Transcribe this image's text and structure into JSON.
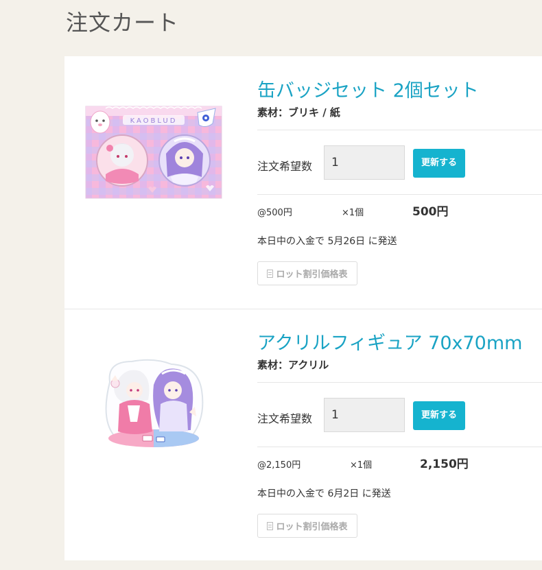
{
  "page": {
    "title": "注文カート"
  },
  "items": [
    {
      "title": "缶バッジセット 2個セット",
      "material": "素材：ブリキ / 紙",
      "qty_label": "注文希望数",
      "qty_value": "1",
      "update_label": "更新する",
      "unit_price": "@500円",
      "multiplier": "×1個",
      "subtotal": "500円",
      "shipping": "本日中の入金で 5月26日 に発送",
      "lot_table_label": "ロット割引価格表",
      "image_icon": "badge-set-image"
    },
    {
      "title": "アクリルフィギュア 70x70mm",
      "material": "素材：アクリル",
      "qty_label": "注文希望数",
      "qty_value": "1",
      "update_label": "更新する",
      "unit_price": "@2,150円",
      "multiplier": "×1個",
      "subtotal": "2,150円",
      "shipping": "本日中の入金で 6月2日 に発送",
      "lot_table_label": "ロット割引価格表",
      "image_icon": "acrylic-figure-image"
    }
  ],
  "colors": {
    "accent": "#1aa3c4",
    "button": "#15b3cf",
    "background": "#f4f1ea"
  }
}
